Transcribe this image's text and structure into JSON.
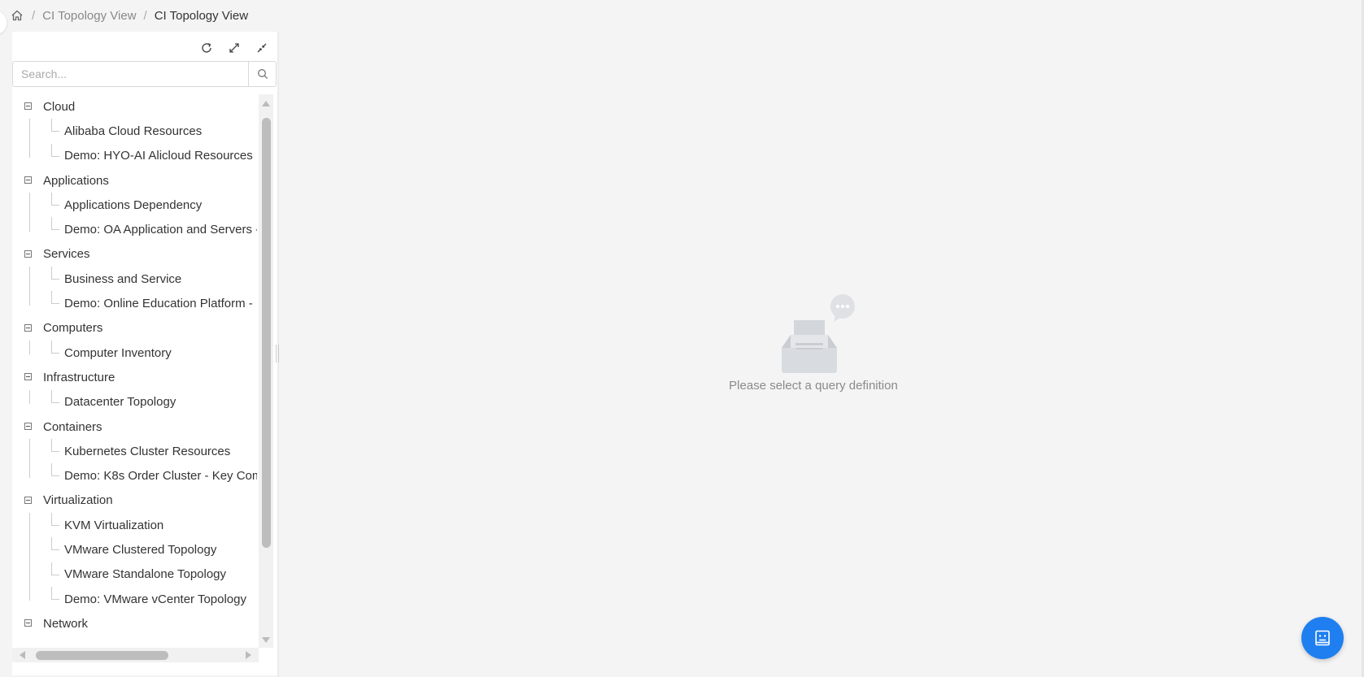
{
  "breadcrumb": {
    "home_icon": "home-icon",
    "separator": "/",
    "items": [
      "CI Topology View",
      "CI Topology View"
    ]
  },
  "toolbar": {
    "icons": [
      "refresh-icon",
      "expand-icon",
      "collapse-icon"
    ]
  },
  "search": {
    "placeholder": "Search...",
    "value": "",
    "icon": "search-icon"
  },
  "tree": {
    "groups": [
      {
        "label": "Cloud",
        "children": [
          "Alibaba Cloud Resources",
          "Demo: HYO-AI Alicloud Resources"
        ]
      },
      {
        "label": "Applications",
        "children": [
          "Applications Dependency",
          "Demo: OA Application and Servers -"
        ]
      },
      {
        "label": "Services",
        "children": [
          "Business and Service",
          "Demo: Online Education Platform -"
        ]
      },
      {
        "label": "Computers",
        "children": [
          "Computer Inventory"
        ]
      },
      {
        "label": "Infrastructure",
        "children": [
          "Datacenter Topology"
        ]
      },
      {
        "label": "Containers",
        "children": [
          "Kubernetes Cluster Resources",
          "Demo: K8s Order Cluster - Key Com"
        ]
      },
      {
        "label": "Virtualization",
        "children": [
          "KVM Virtualization",
          "VMware Clustered Topology",
          "VMware Standalone Topology",
          "Demo: VMware vCenter Topology"
        ]
      },
      {
        "label": "Network",
        "children": []
      }
    ]
  },
  "empty_state": {
    "icon": "empty-inbox-icon",
    "text": "Please select a query definition"
  },
  "fab": {
    "icon": "assistant-bot-icon"
  },
  "colors": {
    "accent": "#1f7ff0",
    "background": "#f4f4f4",
    "panel": "#ffffff"
  }
}
